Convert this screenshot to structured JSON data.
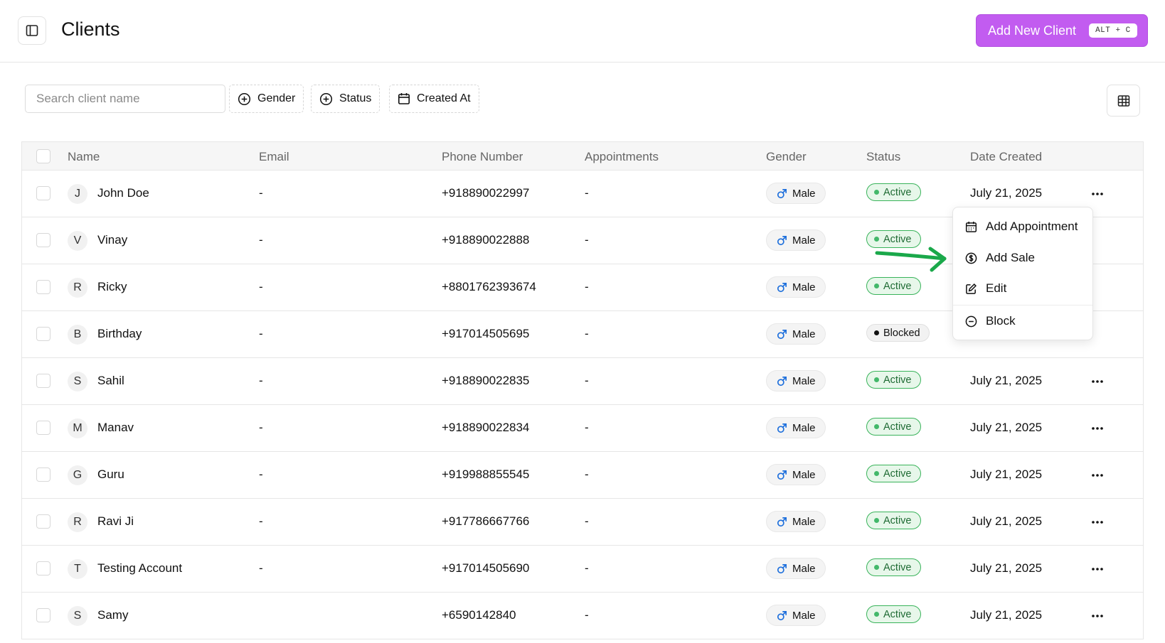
{
  "header": {
    "title": "Clients",
    "add_button_label": "Add New Client",
    "add_button_shortcut": "ALT + C"
  },
  "toolbar": {
    "search_placeholder": "Search client name",
    "filters": [
      "Gender",
      "Status",
      "Created At"
    ]
  },
  "table": {
    "columns": [
      "Name",
      "Email",
      "Phone Number",
      "Appointments",
      "Gender",
      "Status",
      "Date Created"
    ],
    "rows": [
      {
        "initial": "J",
        "name": "John Doe",
        "email": "-",
        "phone": "+918890022997",
        "appointments": "-",
        "gender": "Male",
        "status": "Active",
        "date": "July 21, 2025"
      },
      {
        "initial": "V",
        "name": "Vinay",
        "email": "-",
        "phone": "+918890022888",
        "appointments": "-",
        "gender": "Male",
        "status": "Active",
        "date": ""
      },
      {
        "initial": "R",
        "name": "Ricky",
        "email": "-",
        "phone": "+8801762393674",
        "appointments": "-",
        "gender": "Male",
        "status": "Active",
        "date": ""
      },
      {
        "initial": "B",
        "name": "Birthday",
        "email": "-",
        "phone": "+917014505695",
        "appointments": "-",
        "gender": "Male",
        "status": "Blocked",
        "date": ""
      },
      {
        "initial": "S",
        "name": "Sahil",
        "email": "-",
        "phone": "+918890022835",
        "appointments": "-",
        "gender": "Male",
        "status": "Active",
        "date": "July 21, 2025"
      },
      {
        "initial": "M",
        "name": "Manav",
        "email": "-",
        "phone": "+918890022834",
        "appointments": "-",
        "gender": "Male",
        "status": "Active",
        "date": "July 21, 2025"
      },
      {
        "initial": "G",
        "name": "Guru",
        "email": "-",
        "phone": "+919988855545",
        "appointments": "-",
        "gender": "Male",
        "status": "Active",
        "date": "July 21, 2025"
      },
      {
        "initial": "R",
        "name": "Ravi Ji",
        "email": "-",
        "phone": "+917786667766",
        "appointments": "-",
        "gender": "Male",
        "status": "Active",
        "date": "July 21, 2025"
      },
      {
        "initial": "T",
        "name": "Testing Account",
        "email": "-",
        "phone": "+917014505690",
        "appointments": "-",
        "gender": "Male",
        "status": "Active",
        "date": "July 21, 2025"
      },
      {
        "initial": "S",
        "name": "Samy",
        "email": "",
        "phone": "+6590142840",
        "appointments": "-",
        "gender": "Male",
        "status": "Active",
        "date": "July 21, 2025"
      }
    ]
  },
  "row_menu": {
    "items": [
      "Add Appointment",
      "Add Sale",
      "Edit",
      "Block"
    ]
  },
  "colors": {
    "accent": "#c25cf0",
    "active_green": "#39b35a",
    "arrow_green": "#1aa84a"
  },
  "icons": {
    "sidebar": "sidebar-toggle-icon",
    "filter": "plus-circle-icon",
    "calendar": "calendar-icon",
    "view": "table-grid-icon",
    "gender": "male-icon",
    "row_action": "more-horizontal-icon",
    "menu": [
      "calendar-icon",
      "dollar-circle-icon",
      "edit-icon",
      "block-icon"
    ]
  }
}
